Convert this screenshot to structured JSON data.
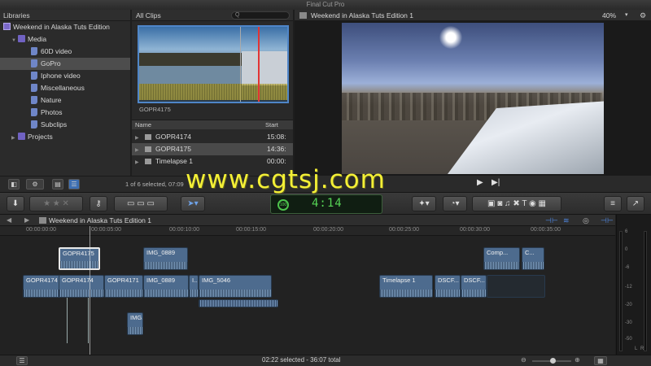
{
  "window": {
    "title": "Final Cut Pro"
  },
  "libraries": {
    "header": "Libraries",
    "items": [
      {
        "label": "Weekend in Alaska Tuts Edition",
        "kind": "library"
      },
      {
        "label": "Media",
        "kind": "event"
      },
      {
        "label": "60D video",
        "kind": "keyword"
      },
      {
        "label": "GoPro",
        "kind": "keyword",
        "selected": true
      },
      {
        "label": "Iphone video",
        "kind": "keyword"
      },
      {
        "label": "Miscellaneous",
        "kind": "keyword"
      },
      {
        "label": "Nature",
        "kind": "keyword"
      },
      {
        "label": "Photos",
        "kind": "keyword"
      },
      {
        "label": "Subclips",
        "kind": "keyword"
      },
      {
        "label": "Projects",
        "kind": "event"
      }
    ]
  },
  "browser": {
    "filter": "All Clips",
    "search_placeholder": "Q",
    "filmstrip_name": "GOPR4175",
    "columns": {
      "name": "Name",
      "start": "Start"
    },
    "rows": [
      {
        "name": "GOPR4174",
        "start": "15:08:"
      },
      {
        "name": "GOPR4175",
        "start": "14:36:"
      },
      {
        "name": "Timelapse 1",
        "start": "00:00:"
      }
    ],
    "selection_status": "1 of 6 selected, 07:09"
  },
  "viewer": {
    "title": "Weekend in Alaska Tuts Edition 1",
    "zoom": "40%"
  },
  "toolbar": {
    "timecode": "4:14",
    "percent_label": "100"
  },
  "timeline": {
    "title": "Weekend in Alaska Tuts Edition 1",
    "ruler_ticks": [
      "00:00:00:00",
      "00:00:05:00",
      "00:00:10:00",
      "00:00:15:00",
      "00:00:20:00",
      "00:00:25:00",
      "00:00:30:00",
      "00:00:35:00"
    ],
    "connected_clips": [
      "GOPR4175",
      "IMG_0889",
      "Comp...",
      "C..."
    ],
    "primary_clips": [
      "GOPR4174",
      "GOPR4174",
      "GOPR4171",
      "IMG_0889",
      "I...",
      "IMG_5046",
      "Timelapse 1",
      "DSCF...",
      "DSCF..."
    ],
    "lower_clip": "IMG...",
    "status": "02:22 selected - 36:07 total"
  },
  "meters": {
    "labels": [
      "6",
      "0",
      "-6",
      "-12",
      "-20",
      "-30",
      "-50"
    ],
    "channels": [
      "L",
      "R"
    ]
  },
  "watermark": "www.cgtsj.com",
  "colors": {
    "accent": "#4f86c8",
    "clip": "#4d6b8e",
    "timecode": "#56d455",
    "watermark": "#f4f036"
  }
}
